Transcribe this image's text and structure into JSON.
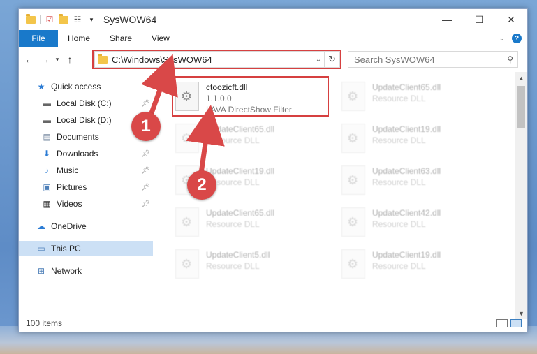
{
  "window": {
    "title": "SysWOW64",
    "controls": {
      "minimize": "—",
      "maximize": "☐",
      "close": "✕"
    }
  },
  "ribbon": {
    "file": "File",
    "tabs": [
      "Home",
      "Share",
      "View"
    ],
    "help": "?"
  },
  "address": {
    "path": "C:\\Windows\\SysWOW64",
    "refresh_glyph": "↻"
  },
  "search": {
    "placeholder": "Search SysWOW64"
  },
  "nav": {
    "items": [
      {
        "label": "Quick access",
        "icon": "star-icon",
        "pinned": false
      },
      {
        "label": "Local Disk (C:)",
        "icon": "drive-icon",
        "pinned": true
      },
      {
        "label": "Local Disk (D:)",
        "icon": "drive-icon",
        "pinned": false
      },
      {
        "label": "Documents",
        "icon": "documents-icon",
        "pinned": true
      },
      {
        "label": "Downloads",
        "icon": "download-icon",
        "pinned": true
      },
      {
        "label": "Music",
        "icon": "music-icon",
        "pinned": true
      },
      {
        "label": "Pictures",
        "icon": "pictures-icon",
        "pinned": true
      },
      {
        "label": "Videos",
        "icon": "video-icon",
        "pinned": true
      },
      {
        "label": "OneDrive",
        "icon": "cloud-icon",
        "pinned": false
      },
      {
        "label": "This PC",
        "icon": "computer-icon",
        "pinned": false,
        "selected": true
      },
      {
        "label": "Network",
        "icon": "network-icon",
        "pinned": false
      }
    ]
  },
  "files": {
    "highlighted": {
      "name": "ctoozicft.dll",
      "version": "1.1.0.0",
      "desc": "LAVA DirectShow Filter"
    },
    "background": [
      {
        "name": "UpdateClient65.dll",
        "desc": "Resource DLL"
      },
      {
        "name": "UpdateClient65.dll",
        "desc": "Resource DLL"
      },
      {
        "name": "UpdateClient19.dll",
        "desc": "Resource DLL"
      },
      {
        "name": "UpdateClient19.dll",
        "desc": "Resource DLL"
      },
      {
        "name": "UpdateClient63.dll",
        "desc": "Resource DLL"
      },
      {
        "name": "UpdateClient65.dll",
        "desc": "Resource DLL"
      },
      {
        "name": "UpdateClient42.dll",
        "desc": "Resource DLL"
      },
      {
        "name": "UpdateClient5.dll",
        "desc": "Resource DLL"
      },
      {
        "name": "UpdateClient19.dll",
        "desc": "Resource DLL"
      }
    ]
  },
  "status": {
    "count": "100 items"
  },
  "callouts": [
    "1",
    "2"
  ],
  "colors": {
    "accent": "#1979ca",
    "highlight": "#d64040",
    "callout": "#d94848"
  }
}
